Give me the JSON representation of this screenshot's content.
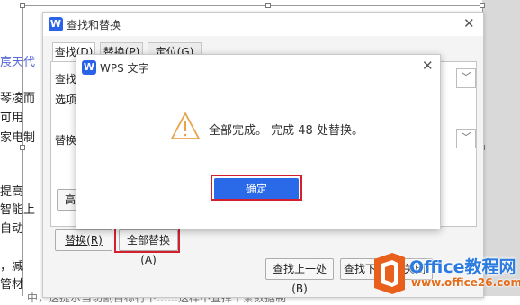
{
  "document": {
    "lines": [
      {
        "text": "宸天代",
        "link": true
      },
      {
        "text": "琴凌而"
      },
      {
        "text": "  可用"
      },
      {
        "text": "家电制"
      },
      {
        "text": " 提高"
      },
      {
        "text": "智能上"
      },
      {
        "text": "  自动"
      },
      {
        "text": "，减"
      },
      {
        "text": "管材"
      },
      {
        "text": "中，这提示当切割目标行下……这样不宜择十条数据制"
      }
    ]
  },
  "find_replace_dialog": {
    "title": "查找和替换",
    "tabs": [
      "查找(D)",
      "替换(P)",
      "定位(G)"
    ],
    "find_label": "查找",
    "options_label": "选项",
    "replace_label": "替换",
    "advanced_button": "高",
    "replace_button": "替换(R)",
    "replace_all_button": "全部替换(A)",
    "find_prev_button": "查找上一处(B)",
    "find_next_button": "查找下一处",
    "close_button": "关闭"
  },
  "message_dialog": {
    "title": "WPS 文字",
    "message": "全部完成。 完成 48 处替换。",
    "ok_button": "确定"
  },
  "watermark": {
    "title": "Office教程网",
    "url": "www.office26.com"
  },
  "icons": {
    "app": "wps-logo-icon",
    "warning": "warning-icon",
    "close": "close-icon",
    "dropdown": "chevron-down-icon",
    "arrow": "annotation-arrow"
  },
  "colors": {
    "accent": "#2a6ae8",
    "annotation_red": "#d3202c",
    "warning_orange": "#e9a24c",
    "office_orange": "#e46d1c",
    "office_blue": "#2b7be0"
  }
}
